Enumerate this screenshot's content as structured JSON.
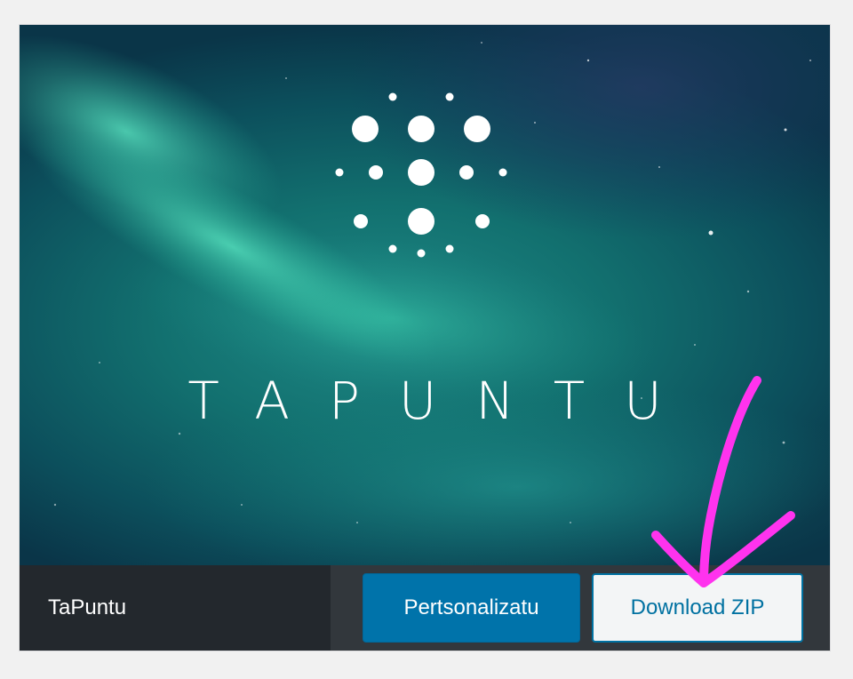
{
  "theme": {
    "name": "TaPuntu",
    "wordmark": "TAPUNTU"
  },
  "actions": {
    "customize_label": "Pertsonalizatu",
    "download_label": "Download ZIP"
  },
  "colors": {
    "primary_button": "#0073aa",
    "secondary_button_text": "#0071a1",
    "bar_background": "#23282d",
    "annotation_arrow": "#ff33ee"
  },
  "icons": {
    "logo": "dot-grid-logo-icon",
    "annotation": "hand-drawn-arrow-icon"
  }
}
